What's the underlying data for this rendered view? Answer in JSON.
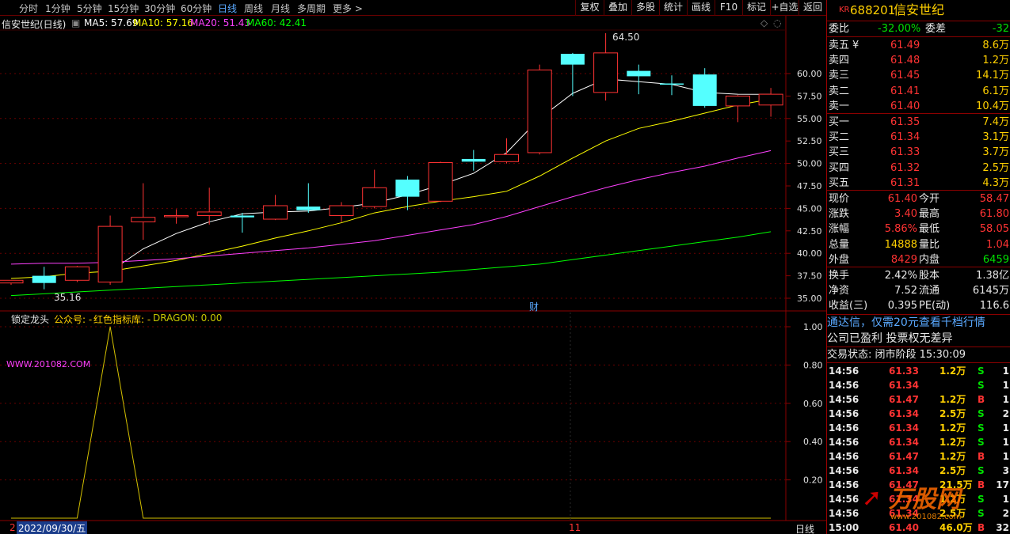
{
  "toolbar": {
    "tabs": [
      "分时",
      "1分钟",
      "5分钟",
      "15分钟",
      "30分钟",
      "60分钟",
      "日线",
      "周线",
      "月线",
      "多周期",
      "更多 >"
    ],
    "active_tab": "日线",
    "buttons": [
      "复权",
      "叠加",
      "多股",
      "统计",
      "画线",
      "F10",
      "标记",
      "+自选",
      "返回"
    ]
  },
  "main_chart": {
    "title": "信安世纪(日线)",
    "ma_labels": [
      {
        "text": "MA5: 57.69",
        "color": "#ffffff"
      },
      {
        "text": "MA10: 57.16",
        "color": "#ffff00"
      },
      {
        "text": "MA20: 51.43",
        "color": "#ff40ff"
      },
      {
        "text": "MA60: 42.41",
        "color": "#00ff00"
      }
    ],
    "y_ticks": [
      "60.00",
      "57.50",
      "55.00",
      "52.50",
      "50.00",
      "47.50",
      "45.00",
      "42.50",
      "40.00",
      "37.50",
      "35.00"
    ],
    "y_tick_values": [
      60,
      57.5,
      55,
      52.5,
      50,
      47.5,
      45,
      42.5,
      40,
      37.5,
      35
    ],
    "high_marker": "64.50",
    "low_marker": "35.16",
    "cai_marker": "财",
    "candles": [
      {
        "o": 36.7,
        "c": 37.0,
        "h": 37.0,
        "l": 36.5
      },
      {
        "o": 37.5,
        "c": 36.7,
        "h": 38.5,
        "l": 36.0
      },
      {
        "o": 37.0,
        "c": 38.5,
        "h": 38.6,
        "l": 36.8
      },
      {
        "o": 36.8,
        "c": 43.0,
        "h": 44.2,
        "l": 36.5
      },
      {
        "o": 43.5,
        "c": 44.0,
        "h": 47.8,
        "l": 41.5
      },
      {
        "o": 44.1,
        "c": 44.2,
        "h": 44.9,
        "l": 43.3
      },
      {
        "o": 44.2,
        "c": 44.6,
        "h": 47.3,
        "l": 43.2
      },
      {
        "o": 44.2,
        "c": 44.0,
        "h": 44.5,
        "l": 42.3
      },
      {
        "o": 43.8,
        "c": 45.3,
        "h": 46.5,
        "l": 43.7
      },
      {
        "o": 45.2,
        "c": 44.8,
        "h": 47.8,
        "l": 44.5
      },
      {
        "o": 44.2,
        "c": 45.3,
        "h": 45.7,
        "l": 43.5
      },
      {
        "o": 45.2,
        "c": 47.3,
        "h": 49.3,
        "l": 45.0
      },
      {
        "o": 48.2,
        "c": 46.3,
        "h": 48.6,
        "l": 44.8
      },
      {
        "o": 45.8,
        "c": 50.1,
        "h": 50.2,
        "l": 45.7
      },
      {
        "o": 50.5,
        "c": 50.2,
        "h": 51.5,
        "l": 49.2
      },
      {
        "o": 50.2,
        "c": 51.0,
        "h": 52.8,
        "l": 50.0
      },
      {
        "o": 51.2,
        "c": 60.4,
        "h": 61.0,
        "l": 51.0
      },
      {
        "o": 62.2,
        "c": 61.0,
        "h": 62.3,
        "l": 57.5
      },
      {
        "o": 57.9,
        "c": 62.3,
        "h": 64.5,
        "l": 57.0
      },
      {
        "o": 60.3,
        "c": 59.7,
        "h": 61.0,
        "l": 57.7
      },
      {
        "o": 58.9,
        "c": 58.8,
        "h": 59.8,
        "l": 57.6
      },
      {
        "o": 59.9,
        "c": 56.4,
        "h": 60.6,
        "l": 56.2
      },
      {
        "o": 56.4,
        "c": 57.5,
        "h": 57.6,
        "l": 54.6
      },
      {
        "o": 56.5,
        "c": 57.7,
        "h": 58.4,
        "l": 55.2
      }
    ],
    "ma5": [
      null,
      null,
      null,
      38.0,
      40.5,
      42.2,
      43.5,
      44.4,
      44.6,
      44.7,
      45.1,
      45.6,
      46.5,
      47.6,
      48.9,
      51.2,
      55.0,
      57.8,
      59.4,
      59.1,
      58.8,
      57.9,
      57.7,
      57.69
    ],
    "ma10": [
      37.2,
      37.4,
      37.8,
      38.0,
      38.6,
      39.2,
      40.0,
      40.8,
      41.7,
      42.5,
      43.4,
      44.5,
      45.2,
      45.8,
      46.3,
      46.9,
      48.6,
      50.6,
      52.5,
      53.9,
      54.7,
      55.6,
      56.5,
      57.16
    ],
    "ma20": [
      38.8,
      38.9,
      38.9,
      39.0,
      39.2,
      39.4,
      39.7,
      40.0,
      40.3,
      40.6,
      41.0,
      41.4,
      42.0,
      42.6,
      43.2,
      44.1,
      45.2,
      46.3,
      47.3,
      48.2,
      49.0,
      49.7,
      50.6,
      51.43
    ],
    "ma60": [
      35.3,
      35.5,
      35.7,
      35.9,
      36.1,
      36.3,
      36.5,
      36.7,
      36.9,
      37.1,
      37.3,
      37.5,
      37.7,
      37.9,
      38.2,
      38.5,
      38.8,
      39.3,
      39.8,
      40.3,
      40.8,
      41.3,
      41.8,
      42.41
    ]
  },
  "indicator": {
    "title": "锁定龙头",
    "gzh": "公众号: -",
    "lib": "红色指标库: -",
    "dragon": "DRAGON: 0.00",
    "watermark": "WWW.201082.COM",
    "y_ticks": [
      "1.00",
      "0.80",
      "0.60",
      "0.40",
      "0.20"
    ],
    "y_tick_values": [
      1.0,
      0.8,
      0.6,
      0.4,
      0.2
    ],
    "values": [
      0,
      0,
      0,
      1,
      0,
      0,
      0,
      0,
      0,
      0,
      0,
      0,
      0,
      0,
      0,
      0,
      0,
      0,
      0,
      0,
      0,
      0,
      0,
      0
    ]
  },
  "bottom": {
    "date": "2022/09/30/五",
    "left_num": "2",
    "month_mark": "11",
    "period": "日线"
  },
  "quote": {
    "kr": "KR",
    "code": "688201",
    "name": "信安世纪",
    "weibi_label": "委比",
    "weibi_val": "-32.00%",
    "weicha_label": "委差",
    "weicha_val": "-32",
    "sell": [
      {
        "label": "卖五",
        "price": "61.49",
        "vol": "8.6万"
      },
      {
        "label": "卖四",
        "price": "61.48",
        "vol": "1.2万"
      },
      {
        "label": "卖三",
        "price": "61.45",
        "vol": "14.1万"
      },
      {
        "label": "卖二",
        "price": "61.41",
        "vol": "6.1万"
      },
      {
        "label": "卖一",
        "price": "61.40",
        "vol": "10.4万"
      }
    ],
    "sell_yen": "¥",
    "buy": [
      {
        "label": "买一",
        "price": "61.35",
        "vol": "7.4万"
      },
      {
        "label": "买二",
        "price": "61.34",
        "vol": "3.1万"
      },
      {
        "label": "买三",
        "price": "61.33",
        "vol": "3.7万"
      },
      {
        "label": "买四",
        "price": "61.32",
        "vol": "2.5万"
      },
      {
        "label": "买五",
        "price": "61.31",
        "vol": "4.3万"
      }
    ],
    "stats": [
      {
        "l1": "现价",
        "v1": "61.40",
        "c1": "red",
        "l2": "今开",
        "v2": "58.47",
        "c2": "red"
      },
      {
        "l1": "涨跌",
        "v1": "3.40",
        "c1": "red",
        "l2": "最高",
        "v2": "61.80",
        "c2": "red"
      },
      {
        "l1": "涨幅",
        "v1": "5.86%",
        "c1": "red",
        "l2": "最低",
        "v2": "58.05",
        "c2": "red"
      },
      {
        "l1": "总量",
        "v1": "14888",
        "c1": "yellow",
        "l2": "量比",
        "v2": "1.04",
        "c2": "red"
      },
      {
        "l1": "外盘",
        "v1": "8429",
        "c1": "red",
        "l2": "内盘",
        "v2": "6459",
        "c2": "green"
      }
    ],
    "stats2": [
      {
        "l1": "换手",
        "v1": "2.42%",
        "l2": "股本",
        "v2": "1.38亿"
      },
      {
        "l1": "净资",
        "v1": "7.52",
        "l2": "流通",
        "v2": "6145万"
      },
      {
        "l1": "收益(三)",
        "v1": "0.395",
        "l2": "PE(动)",
        "v2": "116.6"
      }
    ],
    "ad1": "通达信，仅需20元查看千档行情",
    "ad2": "公司已盈利 投票权无差异",
    "status": "交易状态: 闭市阶段 15:30:09",
    "ticks": [
      {
        "t": "14:56",
        "p": "61.33",
        "pc": "red",
        "v": "1.2万",
        "bs": "S",
        "e": "1"
      },
      {
        "t": "14:56",
        "p": "61.34",
        "pc": "red",
        "v": "",
        "bs": "S",
        "e": "1"
      },
      {
        "t": "14:56",
        "p": "61.47",
        "pc": "red",
        "v": "1.2万",
        "bs": "B",
        "e": "1"
      },
      {
        "t": "14:56",
        "p": "61.34",
        "pc": "red",
        "v": "2.5万",
        "bs": "S",
        "e": "2"
      },
      {
        "t": "14:56",
        "p": "61.34",
        "pc": "red",
        "v": "1.2万",
        "bs": "S",
        "e": "1"
      },
      {
        "t": "14:56",
        "p": "61.34",
        "pc": "red",
        "v": "1.2万",
        "bs": "S",
        "e": "1"
      },
      {
        "t": "14:56",
        "p": "61.47",
        "pc": "red",
        "v": "1.2万",
        "bs": "B",
        "e": "1"
      },
      {
        "t": "14:56",
        "p": "61.34",
        "pc": "red",
        "v": "2.5万",
        "bs": "S",
        "e": "3"
      },
      {
        "t": "14:56",
        "p": "61.47",
        "pc": "red",
        "v": "21.5万",
        "bs": "B",
        "e": "17"
      },
      {
        "t": "14:56",
        "p": "61.34",
        "pc": "red",
        "v": "1.2万",
        "bs": "S",
        "e": "1"
      },
      {
        "t": "14:56",
        "p": "61.34",
        "pc": "red",
        "v": "2.5万",
        "bs": "S",
        "e": "2"
      },
      {
        "t": "15:00",
        "p": "61.40",
        "pc": "red",
        "v": "46.0万",
        "bs": "B",
        "e": "32"
      }
    ],
    "watermark": "万股网",
    "watermark_url": "www.201082.com"
  }
}
